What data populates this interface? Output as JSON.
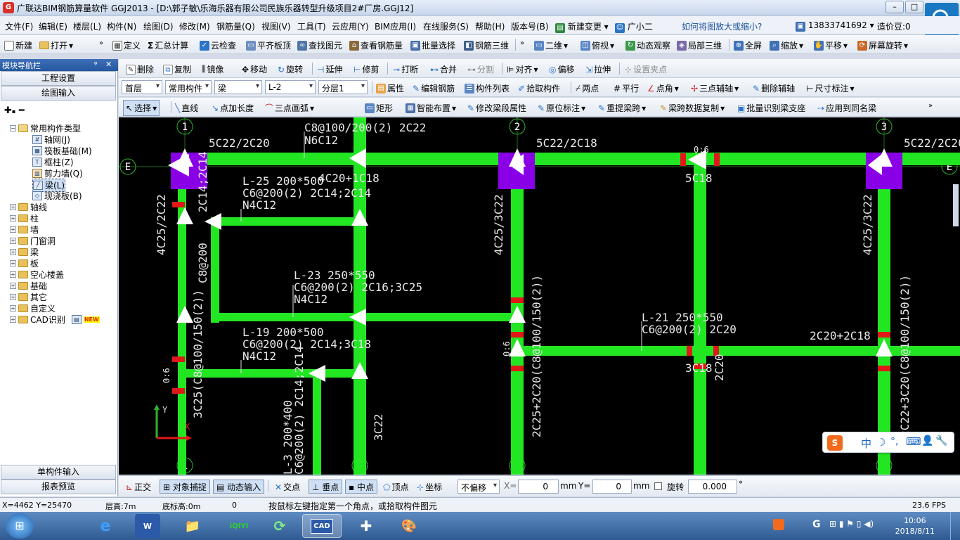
{
  "window": {
    "title": "广联达BIM钢筋算量软件 GGJ2013 - [D:\\郭子敏\\乐海乐器有限公司民族乐器转型升级项目2#厂房.GGJ12]",
    "min": "–",
    "max": "□",
    "close": "✕"
  },
  "menu": {
    "items": [
      "文件(F)",
      "编辑(E)",
      "楼层(L)",
      "构件(N)",
      "绘图(D)",
      "修改(M)",
      "钢筋量(Q)",
      "视图(V)",
      "工具(T)",
      "云应用(Y)",
      "BIM应用(I)",
      "在线服务(S)",
      "帮助(H)",
      "版本号(B)",
      "新建变更",
      "广小二"
    ],
    "help_link": "如何将图放大或缩小?",
    "phone": "13833741692",
    "beans": "造价豆:0"
  },
  "toolbar1": {
    "items": [
      "新建",
      "打开",
      "定义",
      "汇总计算",
      "云检查",
      "平齐板顶",
      "查找图元",
      "查看钢筋量",
      "批量选择",
      "钢筋三维",
      "二维",
      "俯视",
      "动态观察",
      "局部三维",
      "全屏",
      "缩放",
      "平移",
      "屏幕旋转"
    ]
  },
  "toolbar2": {
    "items": [
      "删除",
      "复制",
      "镜像",
      "移动",
      "旋转",
      "延伸",
      "修剪",
      "打断",
      "合并",
      "分割",
      "对齐",
      "偏移",
      "拉伸",
      "设置夹点"
    ]
  },
  "toolbar3": {
    "floor": "首层",
    "comp_type": "常用构件",
    "comp": "梁",
    "name": "L-2",
    "layer": "分层1",
    "items": [
      "属性",
      "编辑钢筋",
      "构件列表",
      "拾取构件",
      "两点",
      "平行",
      "点角",
      "三点辅轴",
      "删除辅轴",
      "尺寸标注"
    ]
  },
  "toolbar4": {
    "items": [
      "选择",
      "直线",
      "点加长度",
      "三点画弧",
      "矩形",
      "智能布置",
      "修改梁段属性",
      "原位标注",
      "重提梁跨",
      "梁跨数据复制",
      "批量识别梁支座",
      "应用到同名梁"
    ]
  },
  "leftpanel": {
    "header": "模块导航栏",
    "pin": "ᵠ",
    "close": "✕",
    "btn_settings": "工程设置",
    "btn_draw": "绘图输入",
    "tree_root": "常用构件类型",
    "tree_common": [
      "轴网(J)",
      "筏板基础(M)",
      "框柱(Z)",
      "剪力墙(Q)",
      "梁(L)",
      "现浇板(B)"
    ],
    "tree_groups": [
      "轴线",
      "柱",
      "墙",
      "门窗洞",
      "梁",
      "板",
      "空心楼盖",
      "基础",
      "其它",
      "自定义",
      "CAD识别"
    ],
    "new_badge": "NEW",
    "btn_single": "单构件输入",
    "btn_report": "报表预览"
  },
  "canvas": {
    "axes": {
      "a1": "1",
      "a2": "2",
      "a3": "3",
      "ae": "E"
    },
    "labels": {
      "t1": "5C22/2C20",
      "t2": "C8@100/200(2) 2C22",
      "t3": "N6C12",
      "t4": "4C20+1C18",
      "t5": "5C22/2C18",
      "t6": "5C22/2C20",
      "t7": "0:6",
      "t8": "5C18",
      "t9": "L-25 200*500",
      "t10": "C6@200(2) 2C14;2C14",
      "t11": "N4C12",
      "t12": "L-23 250*550",
      "t13": "C6@200(2) 2C16;3C25",
      "t14": "N4C12",
      "t15": "L-21 250*550",
      "t16": "C6@200(2) 2C20",
      "t17": "2C20+2C18",
      "t18": "L-19 200*500",
      "t19": "C6@200(2) 2C14;3C18",
      "t20": "N4C12",
      "t21": "3C18",
      "v1": "4C25/2C22",
      "v2": "4C25/3C22",
      "v3": "4C25/3C22",
      "v4": "3C25(C8@100/150(2))",
      "v5": "2C25+2C20(C8@100/150(2))",
      "v6": "2C22+3C20(C8@100/150(2))",
      "v7": "2C14;2C14",
      "v8": "3C22",
      "v9": "L-3 200*400",
      "v10": "C6@200(2) 2C14;2C14",
      "v11": "0:6",
      "v12": "0:6",
      "v13": "C8@200",
      "v14": "2C20",
      "ucs_x": "X",
      "ucs_y": "Y"
    }
  },
  "snapbar": {
    "items": [
      "正交",
      "对象捕捉",
      "动态输入",
      "交点",
      "垂点",
      "中点",
      "顶点",
      "坐标"
    ],
    "offset": "不偏移",
    "x_label": "X=",
    "x_value": "0",
    "mm1": "mm",
    "y_label": "Y=",
    "y_value": "0",
    "mm2": "mm",
    "rotate_label": "旋转",
    "rotate_value": "0.000",
    "deg": "°"
  },
  "status": {
    "coords": "X=4462 Y=25470",
    "floor_height": "层高:7m",
    "base_height": "底标高:0m",
    "zero": "0",
    "hint": "按鼠标左键指定第一个角点，或拾取构件图元",
    "fps": "23.6 FPS"
  },
  "ime": {
    "items": [
      "S",
      "中",
      "☽",
      "°,",
      "⌨",
      "👤",
      "🔧"
    ]
  },
  "taskbar": {
    "start": "⊞",
    "apps": [
      "e",
      "W",
      "📁",
      "iQIYI",
      "⟳",
      "CAD",
      "✚",
      "🎨"
    ],
    "time": "10:06",
    "date": "2018/8/11"
  }
}
